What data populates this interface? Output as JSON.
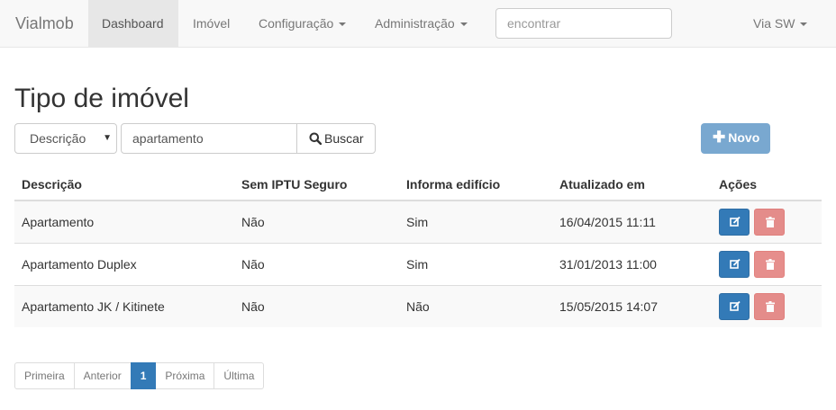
{
  "navbar": {
    "brand": "Vialmob",
    "items": [
      {
        "label": "Dashboard"
      },
      {
        "label": "Imóvel"
      },
      {
        "label": "Configuração"
      },
      {
        "label": "Administração"
      }
    ],
    "search_placeholder": "encontrar",
    "user_label": "Via SW"
  },
  "page": {
    "title": "Tipo de imóvel"
  },
  "filter": {
    "field_select_value": "Descrição",
    "query_value": "apartamento",
    "search_button": "Buscar",
    "new_button": "Novo"
  },
  "table": {
    "headers": [
      "Descrição",
      "Sem IPTU Seguro",
      "Informa edifício",
      "Atualizado em",
      "Ações"
    ],
    "rows": [
      [
        "Apartamento",
        "Não",
        "Sim",
        "16/04/2015 11:11"
      ],
      [
        "Apartamento Duplex",
        "Não",
        "Sim",
        "31/01/2013 11:00"
      ],
      [
        "Apartamento JK / Kitinete",
        "Não",
        "Não",
        "15/05/2015 14:07"
      ]
    ]
  },
  "pagination": {
    "first": "Primeira",
    "previous": "Anterior",
    "current": "1",
    "next": "Próxima",
    "last": "Última"
  },
  "colors": {
    "primary": "#337ab7",
    "danger": "#d9534f",
    "navbar_bg": "#f8f8f8"
  },
  "icons": {
    "search": "search-icon",
    "plus": "plus-icon",
    "edit": "edit-icon",
    "delete": "trash-icon",
    "caret": "caret-down-icon",
    "select_arrow": "triangle-down-icon"
  }
}
